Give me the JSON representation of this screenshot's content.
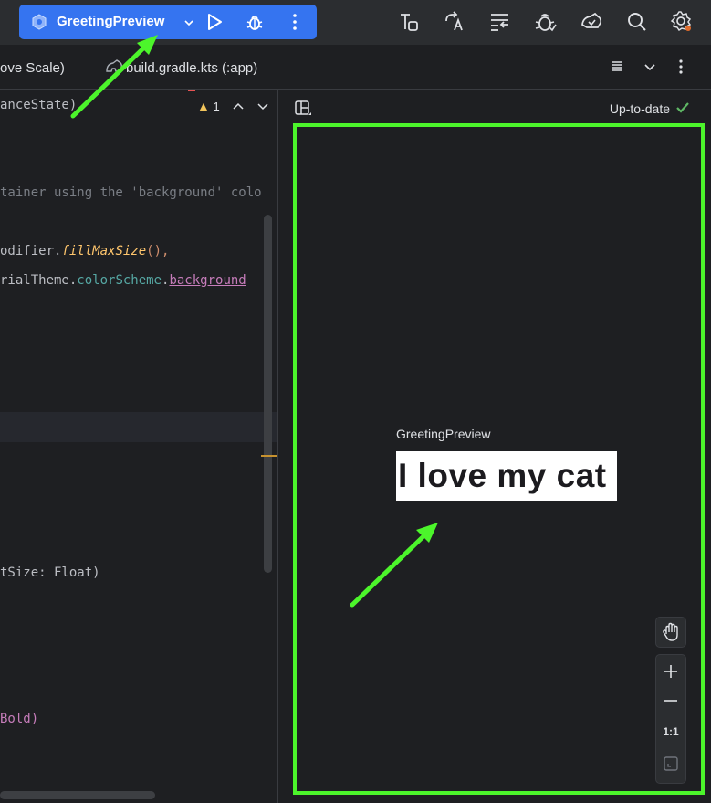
{
  "toolbar": {
    "run_config": "GreetingPreview",
    "icons": [
      "run-icon",
      "debug-icon",
      "more-vertical-icon",
      "build-variants-icon",
      "translate-icon",
      "profiler-icon",
      "app-inspection-icon",
      "device-manager-icon",
      "search-icon",
      "settings-icon"
    ]
  },
  "tabs": {
    "tab1_label": "ove Scale)",
    "tab2_label": "build.gradle.kts (:app)"
  },
  "editor": {
    "warning_count": "1",
    "lines": {
      "l1": "anceState)",
      "l2": "tainer using the 'background' colo",
      "l3a": "odifier.",
      "l3b": "fillMaxSize",
      "l3c": "(),",
      "l4a": "rialTheme.",
      "l4b": "colorScheme",
      "l4c": ".",
      "l4d": "background",
      "l5": "tSize: Float)",
      "l6": "Bold)"
    }
  },
  "preview": {
    "status": "Up-to-date",
    "composable_name": "GreetingPreview",
    "rendered_text": "I love my cat",
    "zoom_reset_label": "1:1"
  },
  "colors": {
    "accent_blue": "#3574f0",
    "highlight_green": "#4cf52b",
    "status_green": "#5fb865"
  }
}
